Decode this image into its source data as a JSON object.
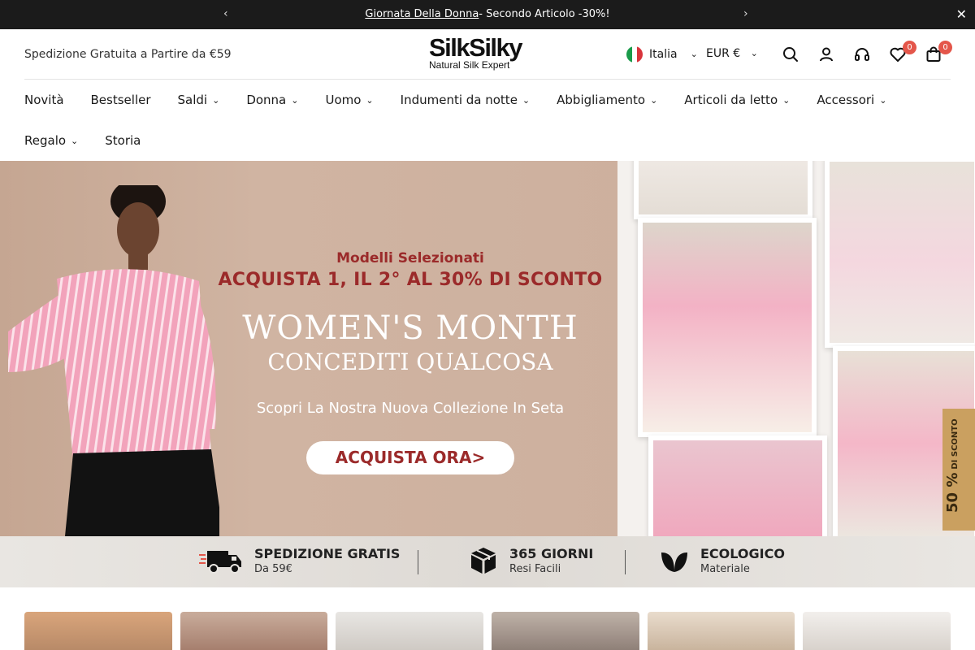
{
  "announcement": {
    "link_text": "Giornata Della Donna",
    "rest_text": "- Secondo Articolo -30%!",
    "prev_icon": "chevron-left-icon",
    "next_icon": "chevron-right-icon",
    "close_icon": "close-icon"
  },
  "header": {
    "shipping_text": "Spedizione Gratuita a Partire da €59",
    "logo_brand": "SilkSilky",
    "logo_tagline": "Natural Silk Expert",
    "country": "Italia",
    "currency": "EUR €",
    "wishlist_count": "0",
    "cart_count": "0",
    "accent_color": "#e4564a"
  },
  "nav": {
    "items": [
      {
        "label": "Novità",
        "dropdown": false
      },
      {
        "label": "Bestseller",
        "dropdown": false
      },
      {
        "label": "Saldi",
        "dropdown": true
      },
      {
        "label": "Donna",
        "dropdown": true
      },
      {
        "label": "Uomo",
        "dropdown": true
      },
      {
        "label": "Indumenti da notte",
        "dropdown": true
      },
      {
        "label": "Abbigliamento",
        "dropdown": true
      },
      {
        "label": "Articoli da letto",
        "dropdown": true
      },
      {
        "label": "Accessori",
        "dropdown": true
      },
      {
        "label": "Regalo",
        "dropdown": true
      },
      {
        "label": "Storia",
        "dropdown": false
      }
    ]
  },
  "hero": {
    "line1": "Modelli Selezionati",
    "line2": "ACQUISTA 1, IL 2° AL 30% DI SCONTO",
    "line3": "WOMEN'S MONTH",
    "line4": "CONCEDITI QUALCOSA",
    "line5": "Scopri La Nostra Nuova Collezione In Seta",
    "cta": "ACQUISTA ORA>",
    "side_tab_value": "50 %",
    "side_tab_text": "DI SCONTO"
  },
  "features": [
    {
      "title": "SPEDIZIONE GRATIS",
      "subtitle": "Da 59€",
      "icon": "truck-icon"
    },
    {
      "title": "365 GIORNI",
      "subtitle": "Resi Facili",
      "icon": "box-icon"
    },
    {
      "title": "ECOLOGICO",
      "subtitle": "Materiale",
      "icon": "leaf-icon"
    }
  ]
}
